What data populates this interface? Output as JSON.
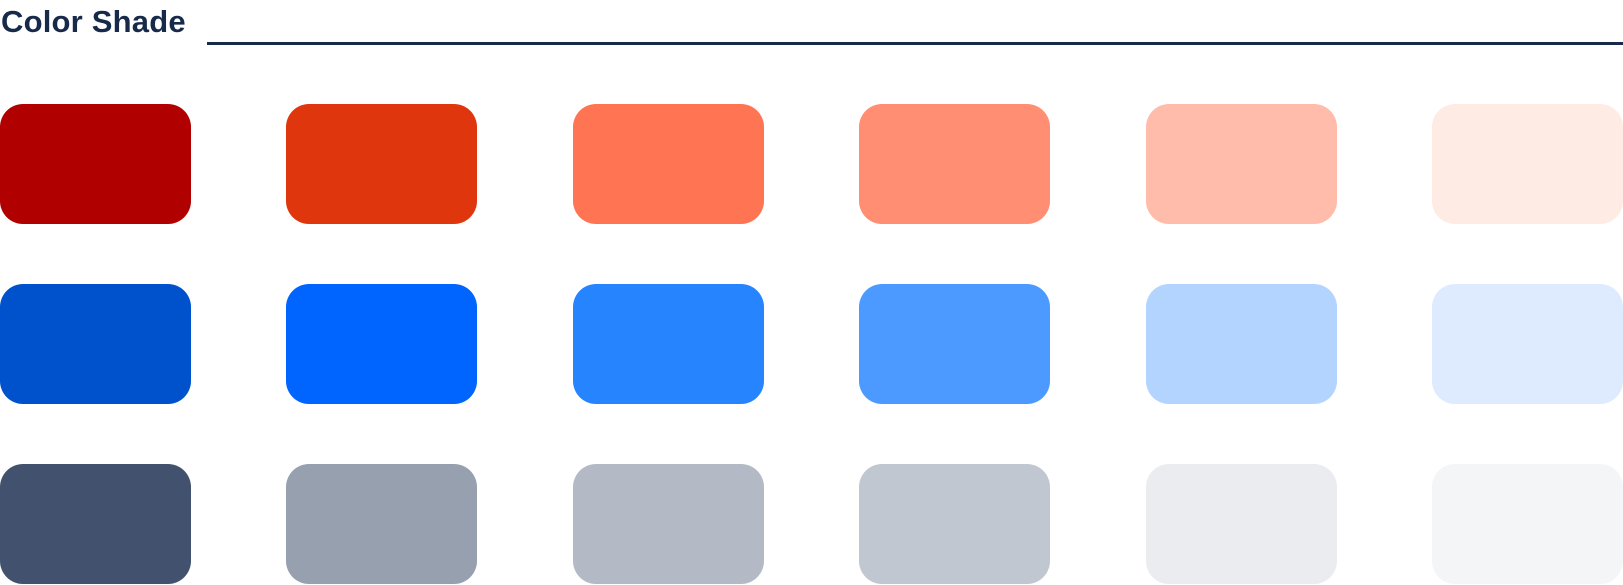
{
  "header": {
    "title": "Color Shade",
    "rule_color": "#172a4a"
  },
  "palette": [
    {
      "name": "red",
      "shades": [
        "#b10000",
        "#df360d",
        "#ff7553",
        "#ff8e72",
        "#ffbcaa",
        "#feebe4"
      ]
    },
    {
      "name": "blue",
      "shades": [
        "#0052cc",
        "#0065ff",
        "#2684ff",
        "#4c9aff",
        "#b3d4ff",
        "#deebff"
      ]
    },
    {
      "name": "gray",
      "shades": [
        "#42526e",
        "#97a0af",
        "#b3bac5",
        "#c1c7d0",
        "#ebecf0",
        "#f4f5f7"
      ]
    }
  ]
}
